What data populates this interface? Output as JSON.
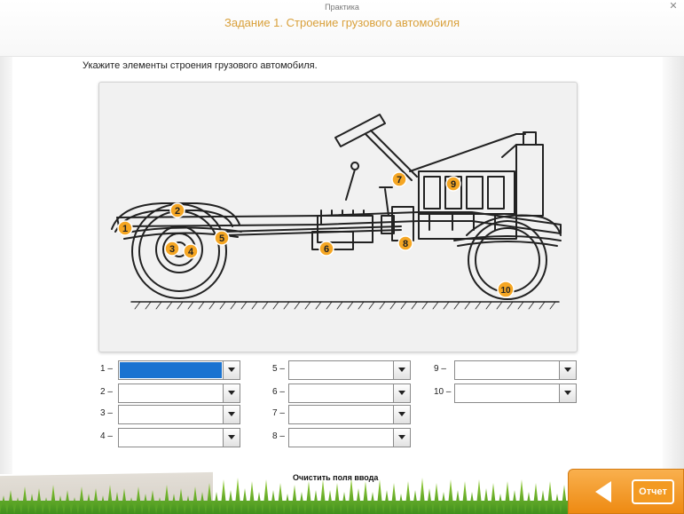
{
  "header": {
    "subtitle": "Практика",
    "title": "Задание 1. Строение грузового автомобиля",
    "close_icon": "close-icon"
  },
  "instruction": "Укажите элементы строения грузового автомобиля.",
  "diagram": {
    "markers": [
      "1",
      "2",
      "3",
      "4",
      "5",
      "6",
      "7",
      "8",
      "9",
      "10"
    ],
    "marker_color": "#f5a623"
  },
  "fields": [
    {
      "label": "1 –",
      "value": "",
      "active": true
    },
    {
      "label": "2 –",
      "value": ""
    },
    {
      "label": "3 –",
      "value": ""
    },
    {
      "label": "4 –",
      "value": ""
    },
    {
      "label": "5 –",
      "value": ""
    },
    {
      "label": "6 –",
      "value": ""
    },
    {
      "label": "7 –",
      "value": ""
    },
    {
      "label": "8 –",
      "value": ""
    },
    {
      "label": "9 –",
      "value": ""
    },
    {
      "label": "10 –",
      "value": ""
    }
  ],
  "footer": {
    "clear_label": "Очистить поля ввода",
    "report_label": "Отчет",
    "accent": "#f39a22"
  }
}
